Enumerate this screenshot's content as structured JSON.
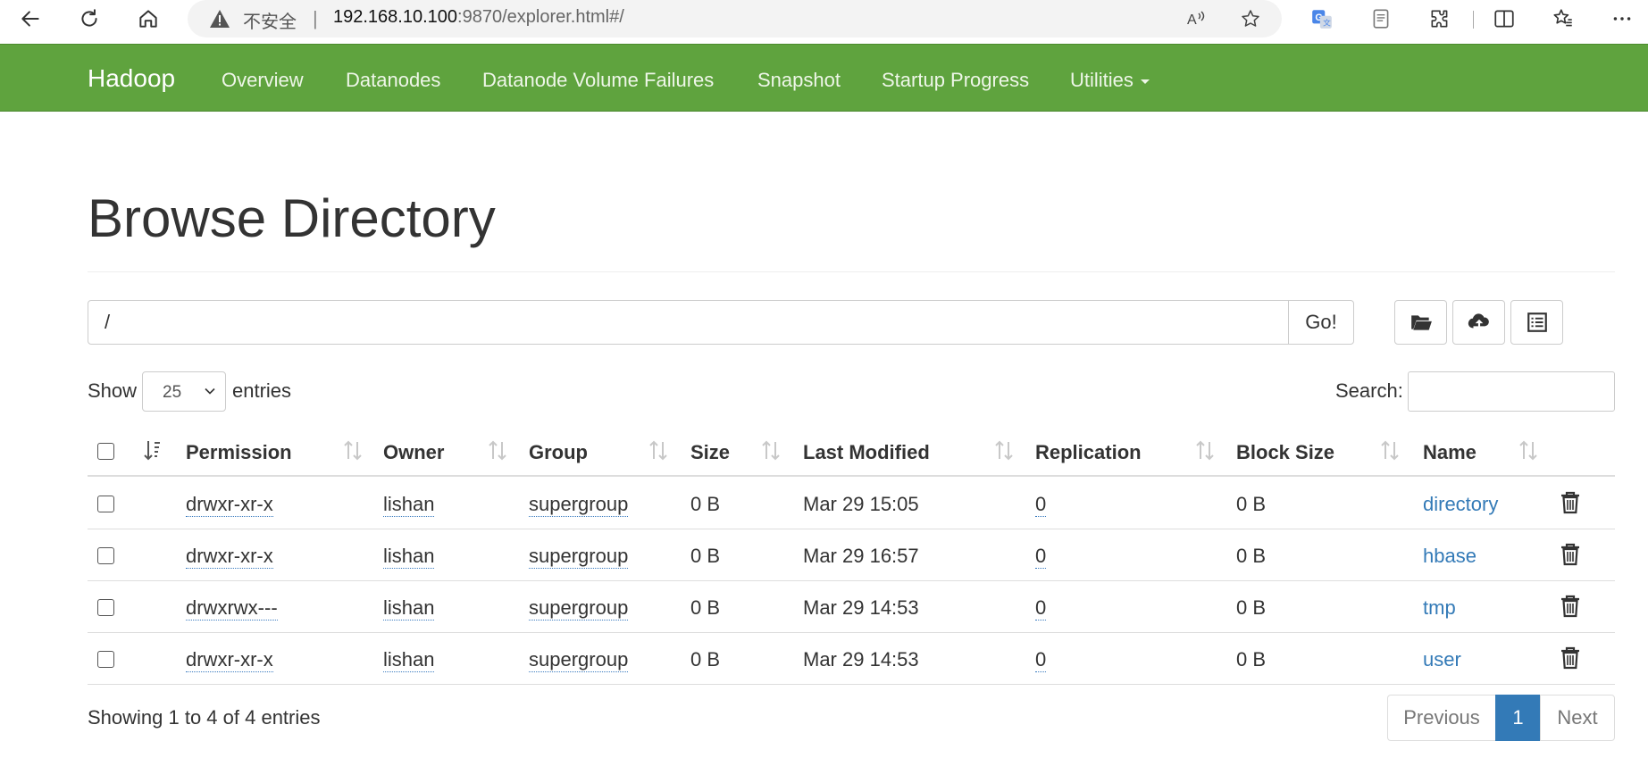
{
  "browser": {
    "security_label": "不安全",
    "url_host": "192.168.10.100",
    "url_path": ":9870/explorer.html#/"
  },
  "navbar": {
    "brand": "Hadoop",
    "items": [
      "Overview",
      "Datanodes",
      "Datanode Volume Failures",
      "Snapshot",
      "Startup Progress",
      "Utilities"
    ]
  },
  "page": {
    "title": "Browse Directory",
    "path_value": "/",
    "go_label": "Go!",
    "show_label": "Show",
    "entries_value": "25",
    "entries_label": "entries",
    "search_label": "Search:"
  },
  "table": {
    "columns": [
      "Permission",
      "Owner",
      "Group",
      "Size",
      "Last Modified",
      "Replication",
      "Block Size",
      "Name"
    ],
    "rows": [
      {
        "permission": "drwxr-xr-x",
        "owner": "lishan",
        "group": "supergroup",
        "size": "0 B",
        "modified": "Mar 29 15:05",
        "replication": "0",
        "block_size": "0 B",
        "name": "directory"
      },
      {
        "permission": "drwxr-xr-x",
        "owner": "lishan",
        "group": "supergroup",
        "size": "0 B",
        "modified": "Mar 29 16:57",
        "replication": "0",
        "block_size": "0 B",
        "name": "hbase"
      },
      {
        "permission": "drwxrwx---",
        "owner": "lishan",
        "group": "supergroup",
        "size": "0 B",
        "modified": "Mar 29 14:53",
        "replication": "0",
        "block_size": "0 B",
        "name": "tmp"
      },
      {
        "permission": "drwxr-xr-x",
        "owner": "lishan",
        "group": "supergroup",
        "size": "0 B",
        "modified": "Mar 29 14:53",
        "replication": "0",
        "block_size": "0 B",
        "name": "user"
      }
    ]
  },
  "footer": {
    "info": "Showing 1 to 4 of 4 entries",
    "previous": "Previous",
    "page": "1",
    "next": "Next"
  },
  "colors": {
    "navbar": "#5fa33e",
    "link": "#337ab7",
    "active_page": "#337ab7"
  },
  "icons": [
    "back-icon",
    "refresh-icon",
    "home-icon",
    "warning-icon",
    "read-aloud-icon",
    "favorite-star-icon",
    "translate-icon",
    "reading-view-icon",
    "extensions-icon",
    "split-screen-icon",
    "favorites-icon",
    "more-icon",
    "folder-open-icon",
    "cloud-upload-icon",
    "list-icon",
    "sort-icon",
    "trash-icon"
  ]
}
